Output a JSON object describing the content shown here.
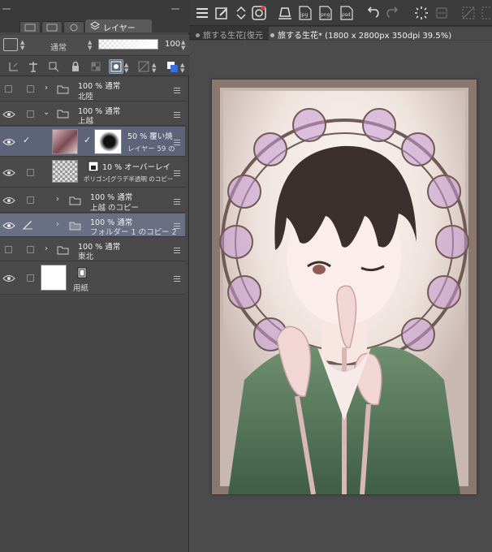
{
  "panel": {
    "tab_label": "レイヤー",
    "blend_mode": "通常",
    "opacity": "100"
  },
  "layers": [
    {
      "line1": "100 %  通常",
      "line2": "北陸"
    },
    {
      "line1": "100 %  通常",
      "line2": "上越"
    },
    {
      "line1": "50 %  覆い焼",
      "line2": "レイヤー 59 の"
    },
    {
      "line1": "10 %  オーバーレイ",
      "line2": "ポリゴン[グラデ半透明 のコピー"
    },
    {
      "line1": "100 %  通常",
      "line2": "上越 のコピー"
    },
    {
      "line1": "100 %  通常",
      "line2": "フォルダー 1 のコピー 2"
    },
    {
      "line1": "100 %  通常",
      "line2": "東北"
    },
    {
      "line1": "",
      "line2": "用紙"
    }
  ],
  "toolbar": {
    "jpg": "jpg",
    "png": "png",
    "psd": "psd"
  },
  "tabs": {
    "doc1": "旅する生花[復元",
    "doc2": "旅する生花* (1800 x 2800px 350dpi 39.5%)"
  },
  "colors": {
    "selection": "#5d6479",
    "panel": "#474747",
    "accent_blue": "#3a6fd8"
  }
}
